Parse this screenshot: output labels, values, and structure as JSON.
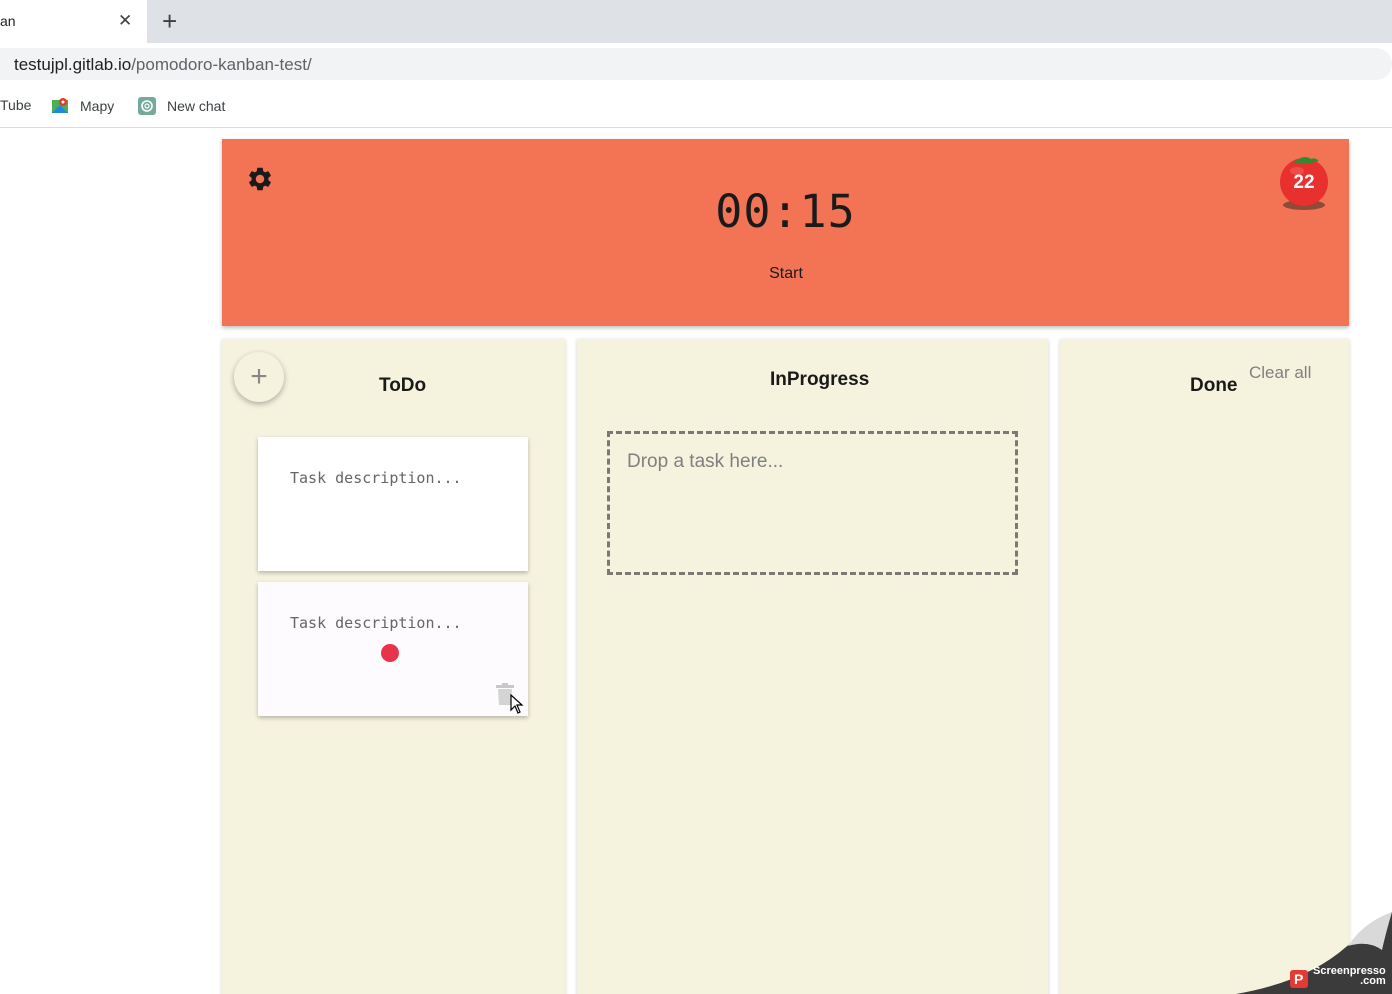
{
  "browser": {
    "tab_title": "an",
    "close_label": "✕",
    "new_tab_label": "+",
    "url_host": "testujpl.gitlab.io",
    "url_path": "/pomodoro-kanban-test/",
    "bookmarks": [
      {
        "label": "Tube"
      },
      {
        "label": "Mapy"
      },
      {
        "label": "New chat"
      }
    ]
  },
  "timer": {
    "time": "00:15",
    "start_label": "Start",
    "tomato_count": "22",
    "background_color": "#f37355",
    "icons": {
      "settings": "gear-icon",
      "tomato": "tomato-icon"
    }
  },
  "board": {
    "columns": [
      {
        "title": "ToDo",
        "add_label": "+",
        "cards": [
          {
            "placeholder": "Task description..."
          },
          {
            "placeholder": "Task description..."
          }
        ]
      },
      {
        "title": "InProgress",
        "drop_placeholder": "Drop a task here..."
      },
      {
        "title": "Done",
        "clear_label": "Clear all"
      }
    ],
    "column_color": "#f5f2de"
  },
  "watermark": {
    "line1": "Screenpresso",
    "line2": ".com"
  }
}
